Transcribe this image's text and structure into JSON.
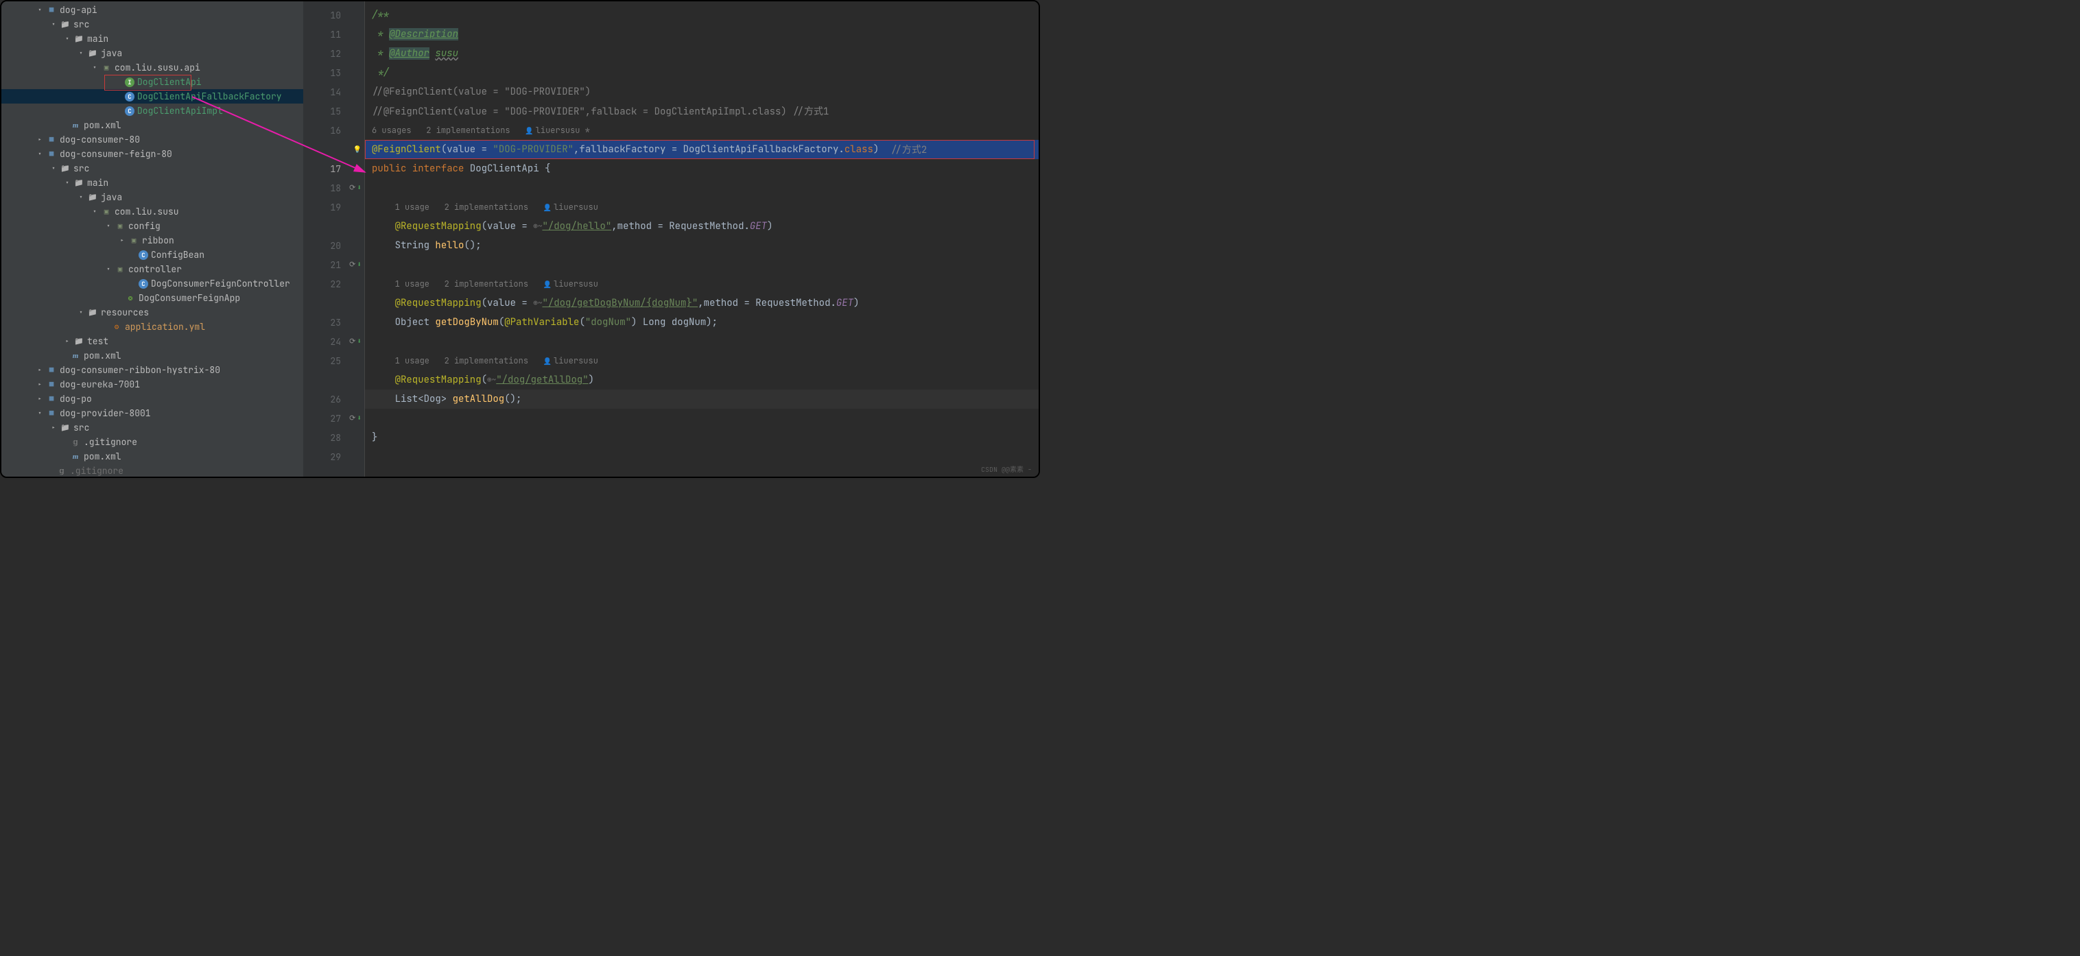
{
  "sidebar": {
    "tree": [
      {
        "indent": 50,
        "chev": "down",
        "ico": "module",
        "text": "dog-api",
        "cls": ""
      },
      {
        "indent": 70,
        "chev": "down",
        "ico": "folder",
        "text": "src",
        "cls": ""
      },
      {
        "indent": 90,
        "chev": "down",
        "ico": "folder",
        "text": "main",
        "cls": ""
      },
      {
        "indent": 110,
        "chev": "down",
        "ico": "folder",
        "text": "java",
        "cls": ""
      },
      {
        "indent": 130,
        "chev": "down",
        "ico": "pkg",
        "text": "com.liu.susu.api",
        "cls": ""
      },
      {
        "indent": 165,
        "chev": "none",
        "ico": "iface",
        "icoLetter": "I",
        "text": "DogClientApi",
        "cls": "link",
        "hl": true
      },
      {
        "indent": 165,
        "chev": "none",
        "ico": "class",
        "icoLetter": "C",
        "text": "DogClientApiFallbackFactory",
        "cls": "link",
        "selected": true
      },
      {
        "indent": 165,
        "chev": "none",
        "ico": "class",
        "icoLetter": "C",
        "text": "DogClientApiImpl",
        "cls": "link"
      },
      {
        "indent": 85,
        "chev": "none",
        "ico": "maven",
        "icoLetter": "m",
        "text": "pom.xml",
        "cls": ""
      },
      {
        "indent": 50,
        "chev": "right",
        "ico": "module",
        "text": "dog-consumer-80",
        "cls": ""
      },
      {
        "indent": 50,
        "chev": "down",
        "ico": "module",
        "text": "dog-consumer-feign-80",
        "cls": ""
      },
      {
        "indent": 70,
        "chev": "down",
        "ico": "folder",
        "text": "src",
        "cls": ""
      },
      {
        "indent": 90,
        "chev": "down",
        "ico": "folder",
        "text": "main",
        "cls": ""
      },
      {
        "indent": 110,
        "chev": "down",
        "ico": "folder",
        "text": "java",
        "cls": ""
      },
      {
        "indent": 130,
        "chev": "down",
        "ico": "pkg",
        "text": "com.liu.susu",
        "cls": ""
      },
      {
        "indent": 150,
        "chev": "down",
        "ico": "pkg",
        "text": "config",
        "cls": ""
      },
      {
        "indent": 170,
        "chev": "right",
        "ico": "pkg",
        "text": "ribbon",
        "cls": ""
      },
      {
        "indent": 185,
        "chev": "none",
        "ico": "class",
        "icoLetter": "C",
        "text": "ConfigBean",
        "cls": ""
      },
      {
        "indent": 150,
        "chev": "down",
        "ico": "pkg",
        "text": "controller",
        "cls": ""
      },
      {
        "indent": 185,
        "chev": "none",
        "ico": "class",
        "icoLetter": "C",
        "text": "DogConsumerFeignController",
        "cls": ""
      },
      {
        "indent": 165,
        "chev": "none",
        "ico": "spring",
        "text": "DogConsumerFeignApp",
        "cls": ""
      },
      {
        "indent": 110,
        "chev": "down",
        "ico": "folder",
        "text": "resources",
        "cls": ""
      },
      {
        "indent": 145,
        "chev": "none",
        "ico": "yaml",
        "text": "application.yml",
        "cls": "api"
      },
      {
        "indent": 90,
        "chev": "right",
        "ico": "folder",
        "text": "test",
        "cls": ""
      },
      {
        "indent": 85,
        "chev": "none",
        "ico": "maven",
        "icoLetter": "m",
        "text": "pom.xml",
        "cls": ""
      },
      {
        "indent": 50,
        "chev": "right",
        "ico": "module",
        "text": "dog-consumer-ribbon-hystrix-80",
        "cls": ""
      },
      {
        "indent": 50,
        "chev": "right",
        "ico": "module",
        "text": "dog-eureka-7001",
        "cls": ""
      },
      {
        "indent": 50,
        "chev": "right",
        "ico": "module",
        "text": "dog-po",
        "cls": ""
      },
      {
        "indent": 50,
        "chev": "down",
        "ico": "module",
        "text": "dog-provider-8001",
        "cls": ""
      },
      {
        "indent": 70,
        "chev": "right",
        "ico": "folder",
        "text": "src",
        "cls": ""
      },
      {
        "indent": 85,
        "chev": "none",
        "ico": "gitignore",
        "text": ".gitignore",
        "cls": ""
      },
      {
        "indent": 85,
        "chev": "none",
        "ico": "maven",
        "icoLetter": "m",
        "text": "pom.xml",
        "cls": ""
      },
      {
        "indent": 65,
        "chev": "none",
        "ico": "gitignore",
        "text": ".gitignore",
        "cls": "muted"
      }
    ]
  },
  "gutter": {
    "lines": [
      {
        "n": "10"
      },
      {
        "n": "11"
      },
      {
        "n": "12"
      },
      {
        "n": "13"
      },
      {
        "n": "14"
      },
      {
        "n": "15"
      },
      {
        "n": "16"
      },
      {
        "n": "",
        "mark": "bulb"
      },
      {
        "n": "17",
        "current": true
      },
      {
        "n": "18",
        "mark": "dn"
      },
      {
        "n": "19"
      },
      {
        "n": ""
      },
      {
        "n": "20"
      },
      {
        "n": "21",
        "mark": "ovdn"
      },
      {
        "n": "22"
      },
      {
        "n": ""
      },
      {
        "n": "23"
      },
      {
        "n": "24",
        "mark": "ovdn"
      },
      {
        "n": "25"
      },
      {
        "n": ""
      },
      {
        "n": "26"
      },
      {
        "n": "27",
        "mark": "ovdn"
      },
      {
        "n": "28"
      },
      {
        "n": "29"
      }
    ]
  },
  "code": {
    "doc_start": "/**",
    "doc_desc_star": " * ",
    "doc_desc_tag": "@Description",
    "doc_auth_star": " * ",
    "doc_auth_tag": "@Author",
    "doc_auth_val": "susu",
    "doc_end": " */",
    "cmt1": "//@FeignClient(value = \"DOG-PROVIDER\")",
    "cmt2": "//@FeignClient(value = \"DOG-PROVIDER\",fallback = DogClientApiImpl.class) //方式1",
    "hint1_usages": "6 usages",
    "hint1_impl": "2 implementations",
    "hint1_author": "liuersusu *",
    "l17_anno": "@FeignClient",
    "l17_open": "(value = ",
    "l17_val": "\"DOG-PROVIDER\"",
    "l17_mid": ",fallbackFactory = DogClientApiFallbackFactory.",
    "l17_kw": "class",
    "l17_close": ")  ",
    "l17_cmt": "//方式2",
    "l18_kw1": "public",
    "l18_kw2": "interface",
    "l18_name": "DogClientApi",
    "l18_brace": " {",
    "hint2_usages": "1 usage",
    "hint2_impl": "2 implementations",
    "hint2_author": "liuersusu",
    "l20_anno": "@RequestMapping",
    "l20_open": "(value = ",
    "l20_linkicon": "⊕~",
    "l20_val": "\"/dog/hello\"",
    "l20_mid": ",method = RequestMethod.",
    "l20_get": "GET",
    "l20_close": ")",
    "l21_type": "String ",
    "l21_name": "hello",
    "l21_close": "();",
    "hint3_usages": "1 usage",
    "hint3_impl": "2 implementations",
    "hint3_author": "liuersusu",
    "l23_anno": "@RequestMapping",
    "l23_open": "(value = ",
    "l23_linkicon": "⊕~",
    "l23_val": "\"/dog/getDogByNum/{dogNum}\"",
    "l23_mid": ",method = RequestMethod.",
    "l23_get": "GET",
    "l23_close": ")",
    "l24_type": "Object ",
    "l24_name": "getDogByNum",
    "l24_open": "(",
    "l24_anno": "@PathVariable",
    "l24_popen": "(",
    "l24_pval": "\"dogNum\"",
    "l24_pclose": ") Long dogNum);",
    "hint4_usages": "1 usage",
    "hint4_impl": "2 implementations",
    "hint4_author": "liuersusu",
    "l26_anno": "@RequestMapping",
    "l26_open": "(",
    "l26_linkicon": "⊕~",
    "l26_val": "\"/dog/getAllDog\"",
    "l26_close": ")",
    "l27_type": "List<Dog> ",
    "l27_name": "getAllDog",
    "l27_close": "();",
    "l29_brace": "}"
  },
  "watermark": "CSDN @@素素 -"
}
